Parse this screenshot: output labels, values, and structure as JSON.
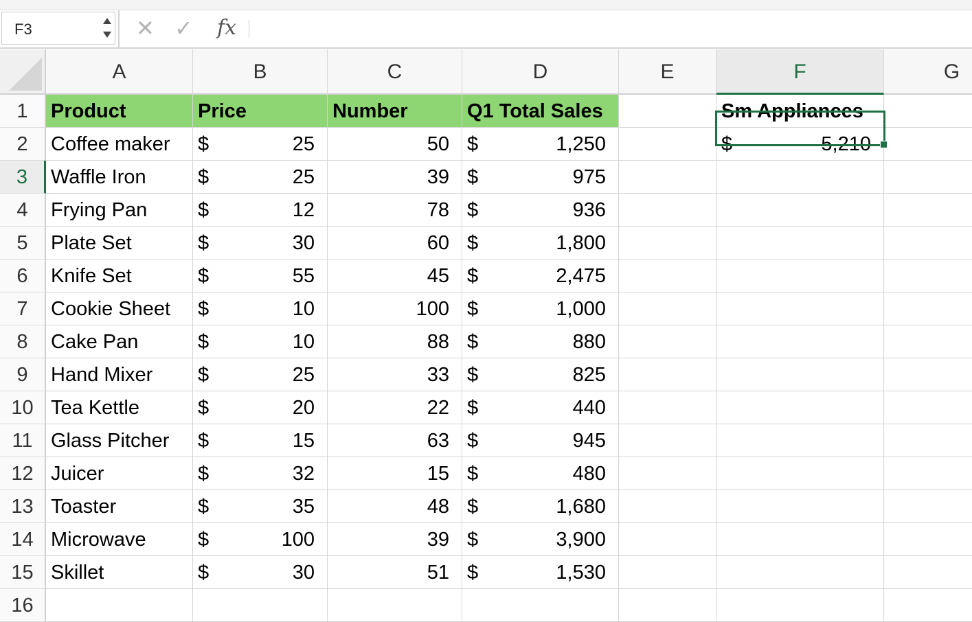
{
  "formula_bar": {
    "name_box": "F3",
    "cancel_icon": "✕",
    "enter_icon": "✓",
    "fx_label": "fx",
    "formula": ""
  },
  "columns": [
    {
      "letter": "A"
    },
    {
      "letter": "B"
    },
    {
      "letter": "C"
    },
    {
      "letter": "D"
    },
    {
      "letter": "E"
    },
    {
      "letter": "F"
    },
    {
      "letter": "G"
    }
  ],
  "rows": [
    "1",
    "2",
    "3",
    "4",
    "5",
    "6",
    "7",
    "8",
    "9",
    "10",
    "11",
    "12",
    "13",
    "14",
    "15",
    "16"
  ],
  "headers": {
    "product": "Product",
    "price": "Price",
    "number": "Number",
    "total": "Q1 Total Sales"
  },
  "currency_symbol": "$",
  "table": [
    {
      "product": "Coffee maker",
      "price": "25",
      "number": "50",
      "total": "1,250"
    },
    {
      "product": "Waffle Iron",
      "price": "25",
      "number": "39",
      "total": "975"
    },
    {
      "product": "Frying Pan",
      "price": "12",
      "number": "78",
      "total": "936"
    },
    {
      "product": "Plate Set",
      "price": "30",
      "number": "60",
      "total": "1,800"
    },
    {
      "product": "Knife Set",
      "price": "55",
      "number": "45",
      "total": "2,475"
    },
    {
      "product": "Cookie Sheet",
      "price": "10",
      "number": "100",
      "total": "1,000"
    },
    {
      "product": "Cake Pan",
      "price": "10",
      "number": "88",
      "total": "880"
    },
    {
      "product": "Hand Mixer",
      "price": "25",
      "number": "33",
      "total": "825"
    },
    {
      "product": "Tea Kettle",
      "price": "20",
      "number": "22",
      "total": "440"
    },
    {
      "product": "Glass Pitcher",
      "price": "15",
      "number": "63",
      "total": "945"
    },
    {
      "product": "Juicer",
      "price": "32",
      "number": "15",
      "total": "480"
    },
    {
      "product": "Toaster",
      "price": "35",
      "number": "48",
      "total": "1,680"
    },
    {
      "product": "Microwave",
      "price": "100",
      "number": "39",
      "total": "3,900"
    },
    {
      "product": "Skillet",
      "price": "30",
      "number": "51",
      "total": "1,530"
    }
  ],
  "summary": {
    "label": "Sm Appliances",
    "value": "5,210"
  },
  "selection": {
    "active_cell": "F3",
    "active_column": "F",
    "active_row": "3"
  },
  "colors": {
    "header_fill": "#8ed673",
    "selection": "#1e7145"
  }
}
